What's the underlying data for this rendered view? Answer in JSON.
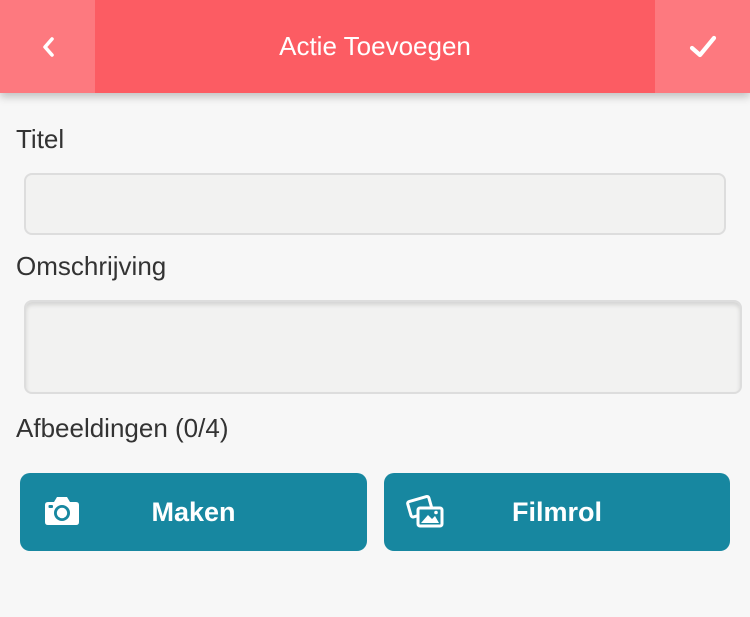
{
  "header": {
    "title": "Actie Toevoegen",
    "back_icon": "chevron-left-icon",
    "confirm_icon": "checkmark-icon",
    "background_color": "#fc5c63",
    "button_color": "#fd797f"
  },
  "form": {
    "title_label": "Titel",
    "title_value": "",
    "description_label": "Omschrijving",
    "description_value": "",
    "images_label": "Afbeeldingen (0/4)"
  },
  "buttons": {
    "take_photo_label": "Maken",
    "take_photo_icon": "camera-icon",
    "camera_roll_label": "Filmrol",
    "camera_roll_icon": "photos-icon",
    "color": "#1787a0"
  }
}
